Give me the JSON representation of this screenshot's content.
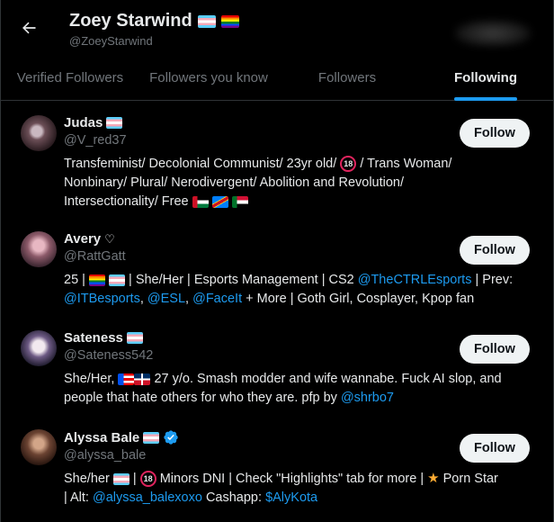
{
  "header": {
    "title": "Zoey Starwind",
    "handle": "@ZoeyStarwind",
    "title_flags": [
      "trans-flag",
      "pride-flag"
    ]
  },
  "tabs": [
    {
      "label": "Verified Followers",
      "active": false
    },
    {
      "label": "Followers you know",
      "active": false
    },
    {
      "label": "Followers",
      "active": false
    },
    {
      "label": "Following",
      "active": true
    }
  ],
  "follow_label": "Follow",
  "users": [
    {
      "name": "Judas",
      "handle": "@V_red37",
      "bio": {
        "line1": "Transfeminist/ Decolonial Communist/ 23yr old/",
        "badge": "18",
        "line1b": "/ Trans Woman/",
        "line2": "Nonbinary/ Plural/ Nerodivergent/ Abolition and Revolution/",
        "line3": "Intersectionality/ Free"
      }
    },
    {
      "name": "Avery",
      "handle": "@RattGatt",
      "bio": {
        "p1": "25 |",
        "p2": "| She/Her | Esports Management | CS2",
        "m1": "@TheCTRLEsports",
        "p3": "| Prev:",
        "m2": "@ITBesports",
        "p4": ",",
        "m3": "@ESL",
        "p5": ",",
        "m4": "@FaceIt",
        "p6": "+ More | Goth Girl, Cosplayer, Kpop fan"
      }
    },
    {
      "name": "Sateness",
      "handle": "@Sateness542",
      "bio": {
        "p1": "She/Her,",
        "p2": "27 y/o. Smash modder and wife wannabe. Fuck AI slop, and",
        "p3": "people that hate others for who they are. pfp by",
        "m1": "@shrbo7"
      }
    },
    {
      "name": "Alyssa Bale",
      "handle": "@alyssa_bale",
      "bio": {
        "p1": "She/her",
        "p2": "|",
        "badge": "18",
        "p3": "Minors DNI | Check \"Highlights\" tab for more |",
        "p4": "Porn Star",
        "p5": "| Alt:",
        "m1": "@alyssa_balexoxo",
        "p6": "Cashapp:",
        "m2": "$AlyKota"
      }
    }
  ],
  "colors": {
    "background": "#000000",
    "accent": "#1d9bf0",
    "muted": "#71767b",
    "text": "#e7e9ea",
    "button": "#eff3f4"
  }
}
